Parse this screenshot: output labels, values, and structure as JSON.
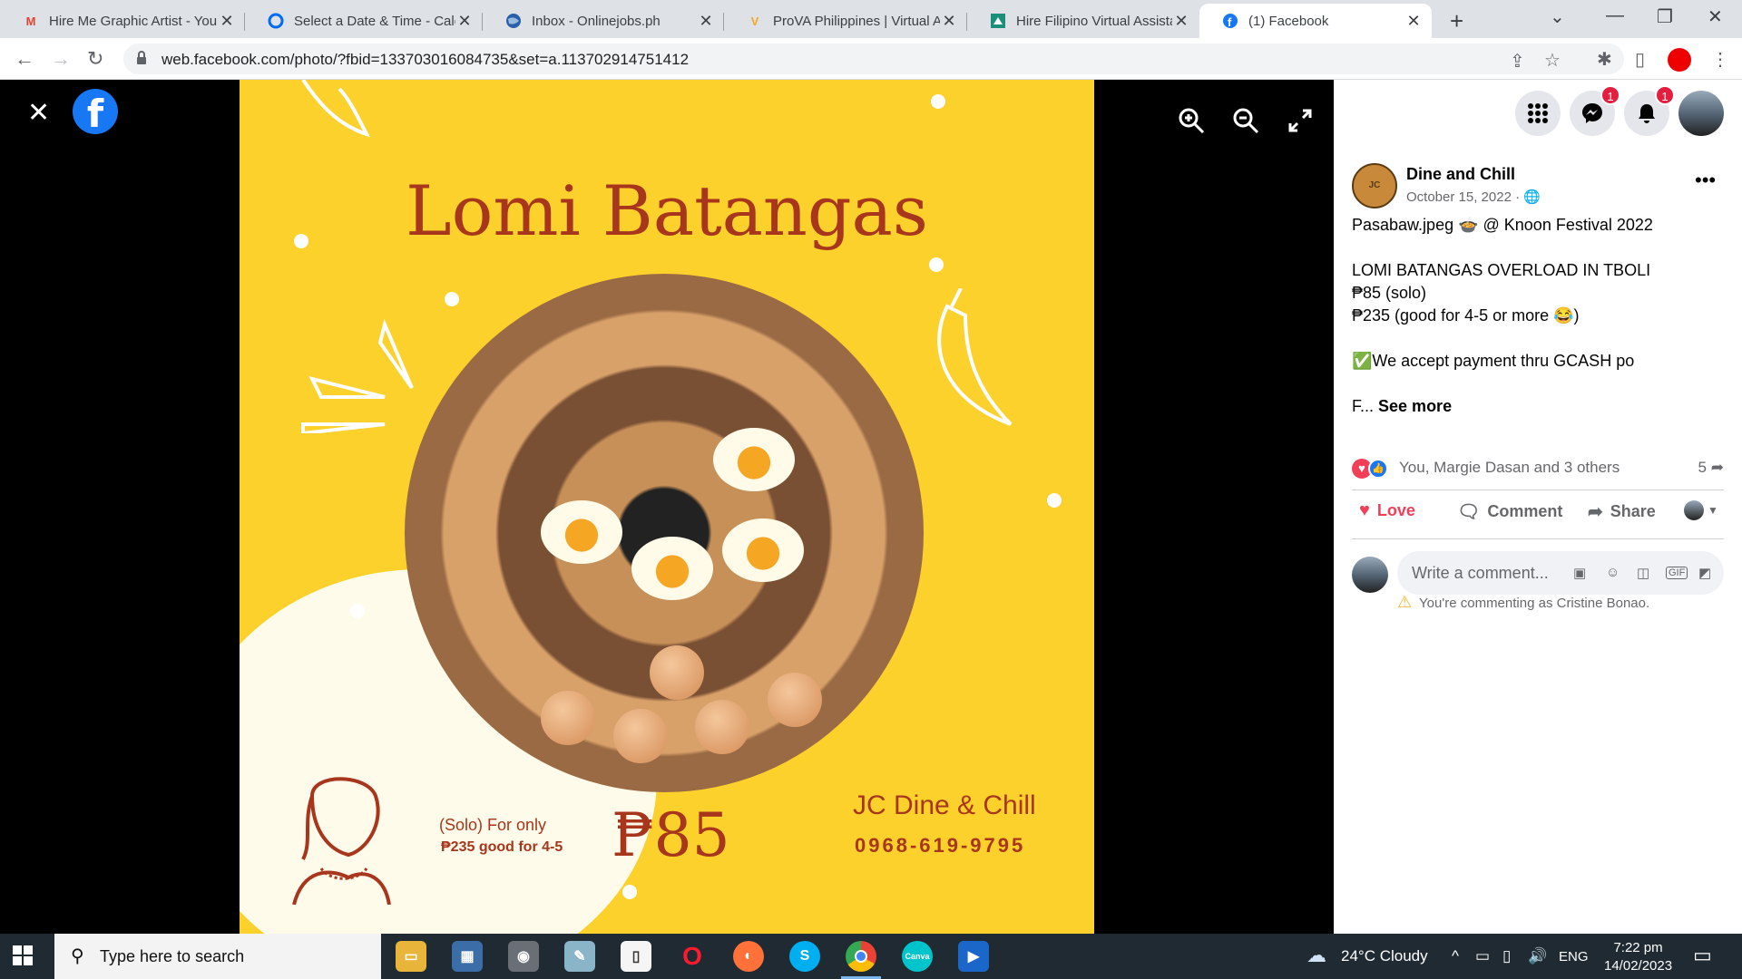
{
  "browser": {
    "tabs": [
      {
        "title": "Hire Me Graphic Artist - You",
        "icon": "gmail-icon"
      },
      {
        "title": "Select a Date & Time - Cale",
        "icon": "calendly-icon"
      },
      {
        "title": "Inbox - Onlinejobs.ph",
        "icon": "globe-icon"
      },
      {
        "title": "ProVA Philippines | Virtual A",
        "icon": "prova-icon"
      },
      {
        "title": "Hire Filipino Virtual Assistan",
        "icon": "hire-icon"
      },
      {
        "title": "(1) Facebook",
        "icon": "facebook-icon"
      }
    ],
    "url": "web.facebook.com/photo/?fbid=133703016084735&set=a.113702914751412",
    "accent_color": "#1877f2"
  },
  "photo": {
    "title": "Lomi Batangas",
    "promo_line1": "(Solo) For only",
    "promo_line2": "₱235 good for 4-5",
    "price": "₱85",
    "business": "JC Dine & Chill",
    "phone": "0968-619-9795",
    "background_color": "#fcd12b"
  },
  "header": {
    "messenger_badge": "1",
    "notifications_badge": "1"
  },
  "post": {
    "page_avatar_text": "JC",
    "page_name": "Dine and Chill",
    "date": "October 15, 2022 ·",
    "lines": [
      "Pasabaw.jpeg 🍲 @ Knoon Festival 2022",
      "LOMI BATANGAS OVERLOAD IN TBOLI",
      "₱85 (solo)",
      "₱235 (good for 4-5 or more 😂)",
      "✅We accept payment thru GCASH po",
      "F..."
    ],
    "see_more": "See more",
    "reactions_text": "You, Margie Dasan and 3 others",
    "share_count": "5",
    "actions": {
      "love": "Love",
      "comment": "Comment",
      "share": "Share"
    },
    "comment_placeholder": "Write a comment...",
    "commenting_as": "You're commenting as Cristine Bonao."
  },
  "taskbar": {
    "search_placeholder": "Type here to search",
    "weather": "24°C  Cloudy",
    "language": "ENG",
    "time": "7:22 pm",
    "date": "14/02/2023"
  }
}
